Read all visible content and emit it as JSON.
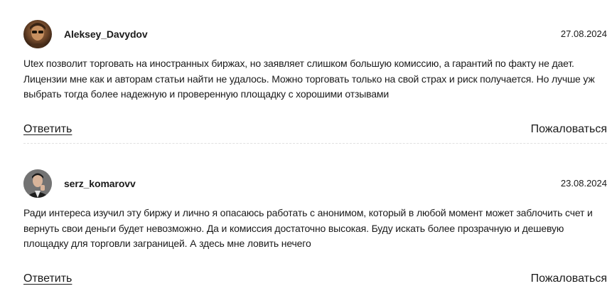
{
  "comments": [
    {
      "username": "Aleksey_Davydov",
      "date": "27.08.2024",
      "text": "Utex позволит торговать на иностранных биржах, но заявляет слишком большую комиссию, а гарантий по факту не дает. Лицензии мне как и авторам статьи найти не удалось. Можно торговать только на свой страх и риск получается. Но лучше уж выбрать тогда более надежную и проверенную площадку с хорошими отзывами",
      "reply_label": "Ответить",
      "report_label": "Пожаловаться"
    },
    {
      "username": "serz_komarovv",
      "date": "23.08.2024",
      "text": "Ради интереса изучил эту биржу и лично я опасаюсь работать с анонимом, который в любой момент может заблочить счет и вернуть свои деньги будет невозможно. Да и комиссия достаточно высокая. Буду искать более прозрачную и дешевую площадку для торговли заграницей. А здесь мне ловить нечего",
      "reply_label": "Ответить",
      "report_label": "Пожаловаться"
    }
  ]
}
